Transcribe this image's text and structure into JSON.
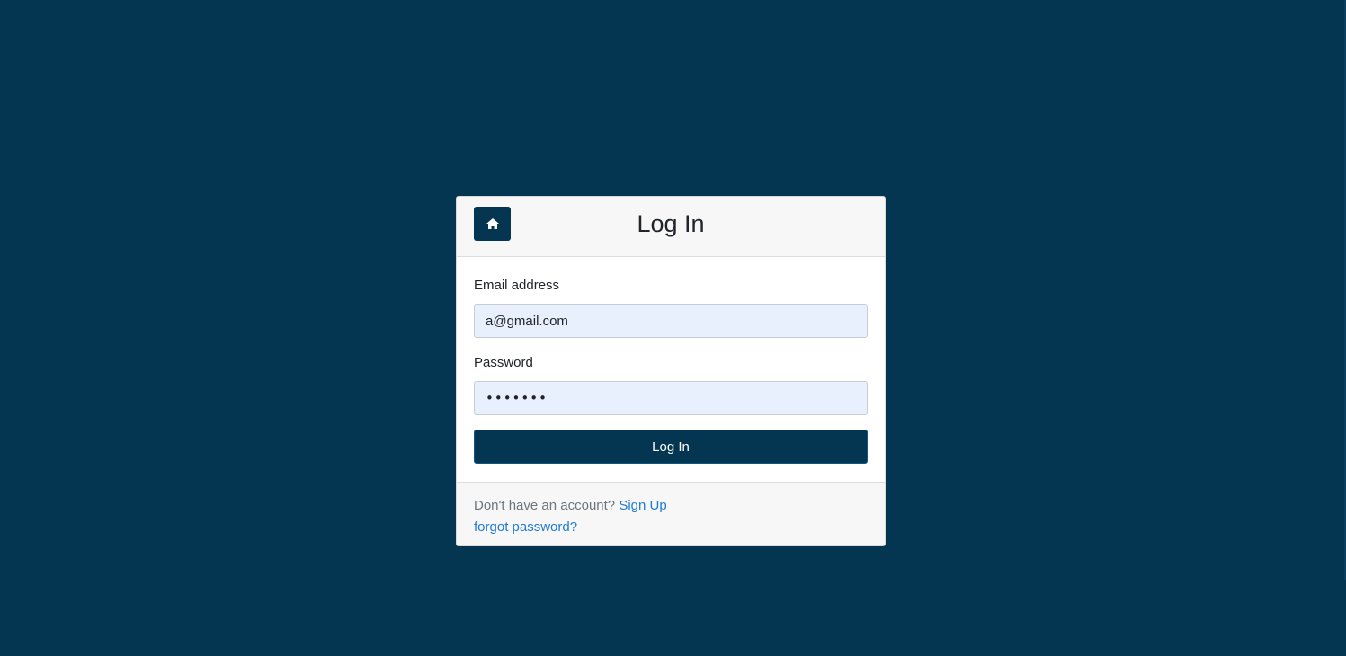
{
  "colors": {
    "background": "#053651",
    "primary_button": "#053651",
    "link": "#1f7bd6",
    "input_fill": "#e8f0fe"
  },
  "header": {
    "home_icon": "home-icon",
    "title": "Log In"
  },
  "form": {
    "email": {
      "label": "Email address",
      "value": "a@gmail.com"
    },
    "password": {
      "label": "Password",
      "value": "•••••••"
    },
    "submit_label": "Log In"
  },
  "footer": {
    "signup_prompt": "Don't have an account?",
    "signup_link": "Sign Up",
    "forgot_link": "forgot password?"
  }
}
